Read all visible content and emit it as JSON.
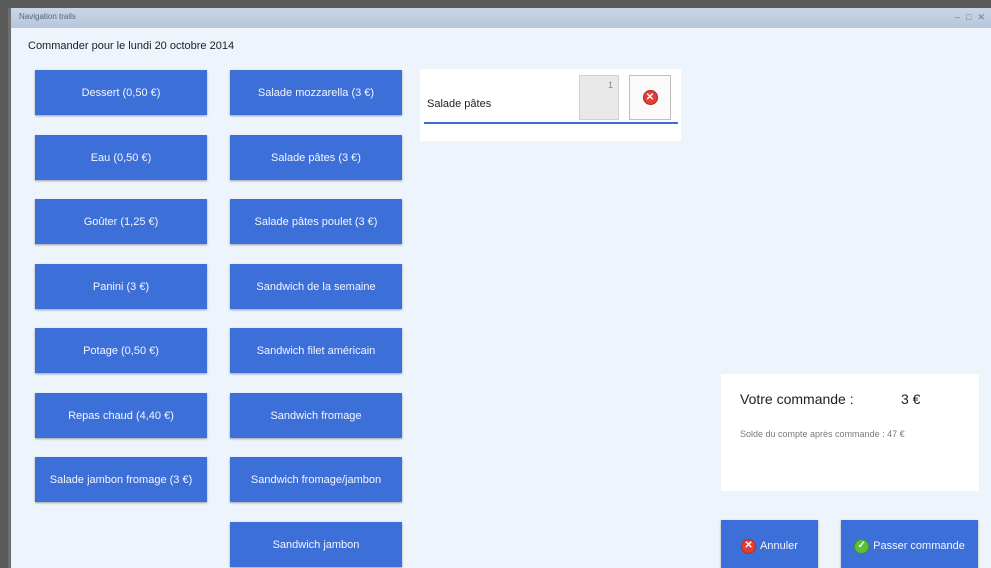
{
  "window": {
    "title": "Navigation trails"
  },
  "page": {
    "title": "Commander pour le lundi 20 octobre 2014"
  },
  "products": [
    {
      "label": "Dessert (0,50 €)"
    },
    {
      "label": "Eau (0,50 €)"
    },
    {
      "label": "Goûter (1,25 €)"
    },
    {
      "label": "Panini (3 €)"
    },
    {
      "label": "Potage (0,50 €)"
    },
    {
      "label": "Repas chaud (4,40 €)"
    },
    {
      "label": "Salade jambon fromage (3 €)"
    },
    {
      "label": "Salade mozzarella (3 €)"
    },
    {
      "label": "Salade pâtes (3 €)"
    },
    {
      "label": "Salade pâtes poulet (3 €)"
    },
    {
      "label": "Sandwich de la semaine"
    },
    {
      "label": "Sandwich filet américain"
    },
    {
      "label": "Sandwich fromage"
    },
    {
      "label": "Sandwich fromage/jambon"
    },
    {
      "label": "Sandwich jambon"
    }
  ],
  "order": {
    "items": [
      {
        "name": "Salade pâtes",
        "quantity": "1"
      }
    ]
  },
  "summary": {
    "label": "Votre commande :",
    "total": "3 €",
    "balance_after": "Solde du compte après commande : 47 €"
  },
  "actions": {
    "cancel_label": "Annuler",
    "submit_label": "Passer commande"
  },
  "colors": {
    "accent": "#3d6fd8",
    "background": "#eef4fc",
    "cancel_icon": "#e04038",
    "confirm_icon": "#5fbf3a"
  },
  "icons": {
    "remove": "remove-icon",
    "cancel": "cancel-icon",
    "confirm": "check-icon"
  }
}
